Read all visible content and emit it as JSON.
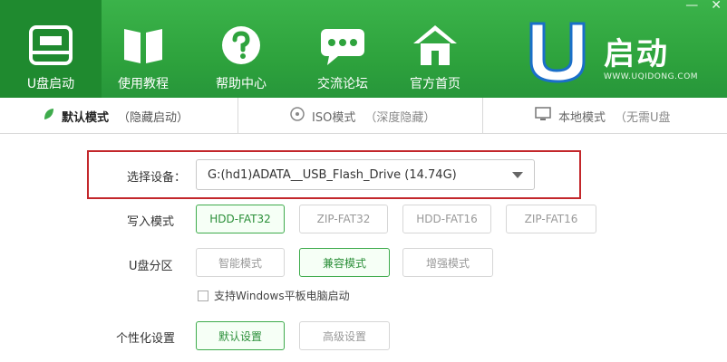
{
  "nav": {
    "items": [
      {
        "label": "U盘启动",
        "icon": "usb-drive-icon",
        "active": true
      },
      {
        "label": "使用教程",
        "icon": "book-icon",
        "active": false
      },
      {
        "label": "帮助中心",
        "icon": "question-icon",
        "active": false
      },
      {
        "label": "交流论坛",
        "icon": "chat-bubble-icon",
        "active": false
      },
      {
        "label": "官方首页",
        "icon": "home-icon",
        "active": false
      }
    ]
  },
  "logo": {
    "text": "启动",
    "url": "WWW.UQIDONG.COM",
    "brand_color": "#27963a"
  },
  "tabs": [
    {
      "label": "默认模式",
      "sub": "（隐藏启动）",
      "icon": "leaf-icon"
    },
    {
      "label": "ISO模式",
      "sub": "（深度隐藏）",
      "icon": "disc-icon"
    },
    {
      "label": "本地模式",
      "sub": "（无需U盘",
      "icon": "monitor-icon"
    }
  ],
  "form": {
    "device_label": "选择设备：",
    "device_value": "G:(hd1)ADATA__USB_Flash_Drive (14.74G)",
    "write_mode_label": "写入模式",
    "write_modes": [
      "HDD-FAT32",
      "ZIP-FAT32",
      "HDD-FAT16",
      "ZIP-FAT16"
    ],
    "write_mode_selected": "HDD-FAT32",
    "partition_label": "U盘分区",
    "partitions": [
      "智能模式",
      "兼容模式",
      "增强模式"
    ],
    "partition_selected": "兼容模式",
    "tablet_checkbox_label": "支持Windows平板电脑启动",
    "tablet_checkbox_checked": false,
    "personalize_label": "个性化设置",
    "personalize_options": [
      "默认设置",
      "高级设置"
    ],
    "personalize_selected": "默认设置"
  },
  "colors": {
    "accent": "#3eab4c",
    "highlight_border": "#c3272b",
    "header": "#2ea33d"
  }
}
